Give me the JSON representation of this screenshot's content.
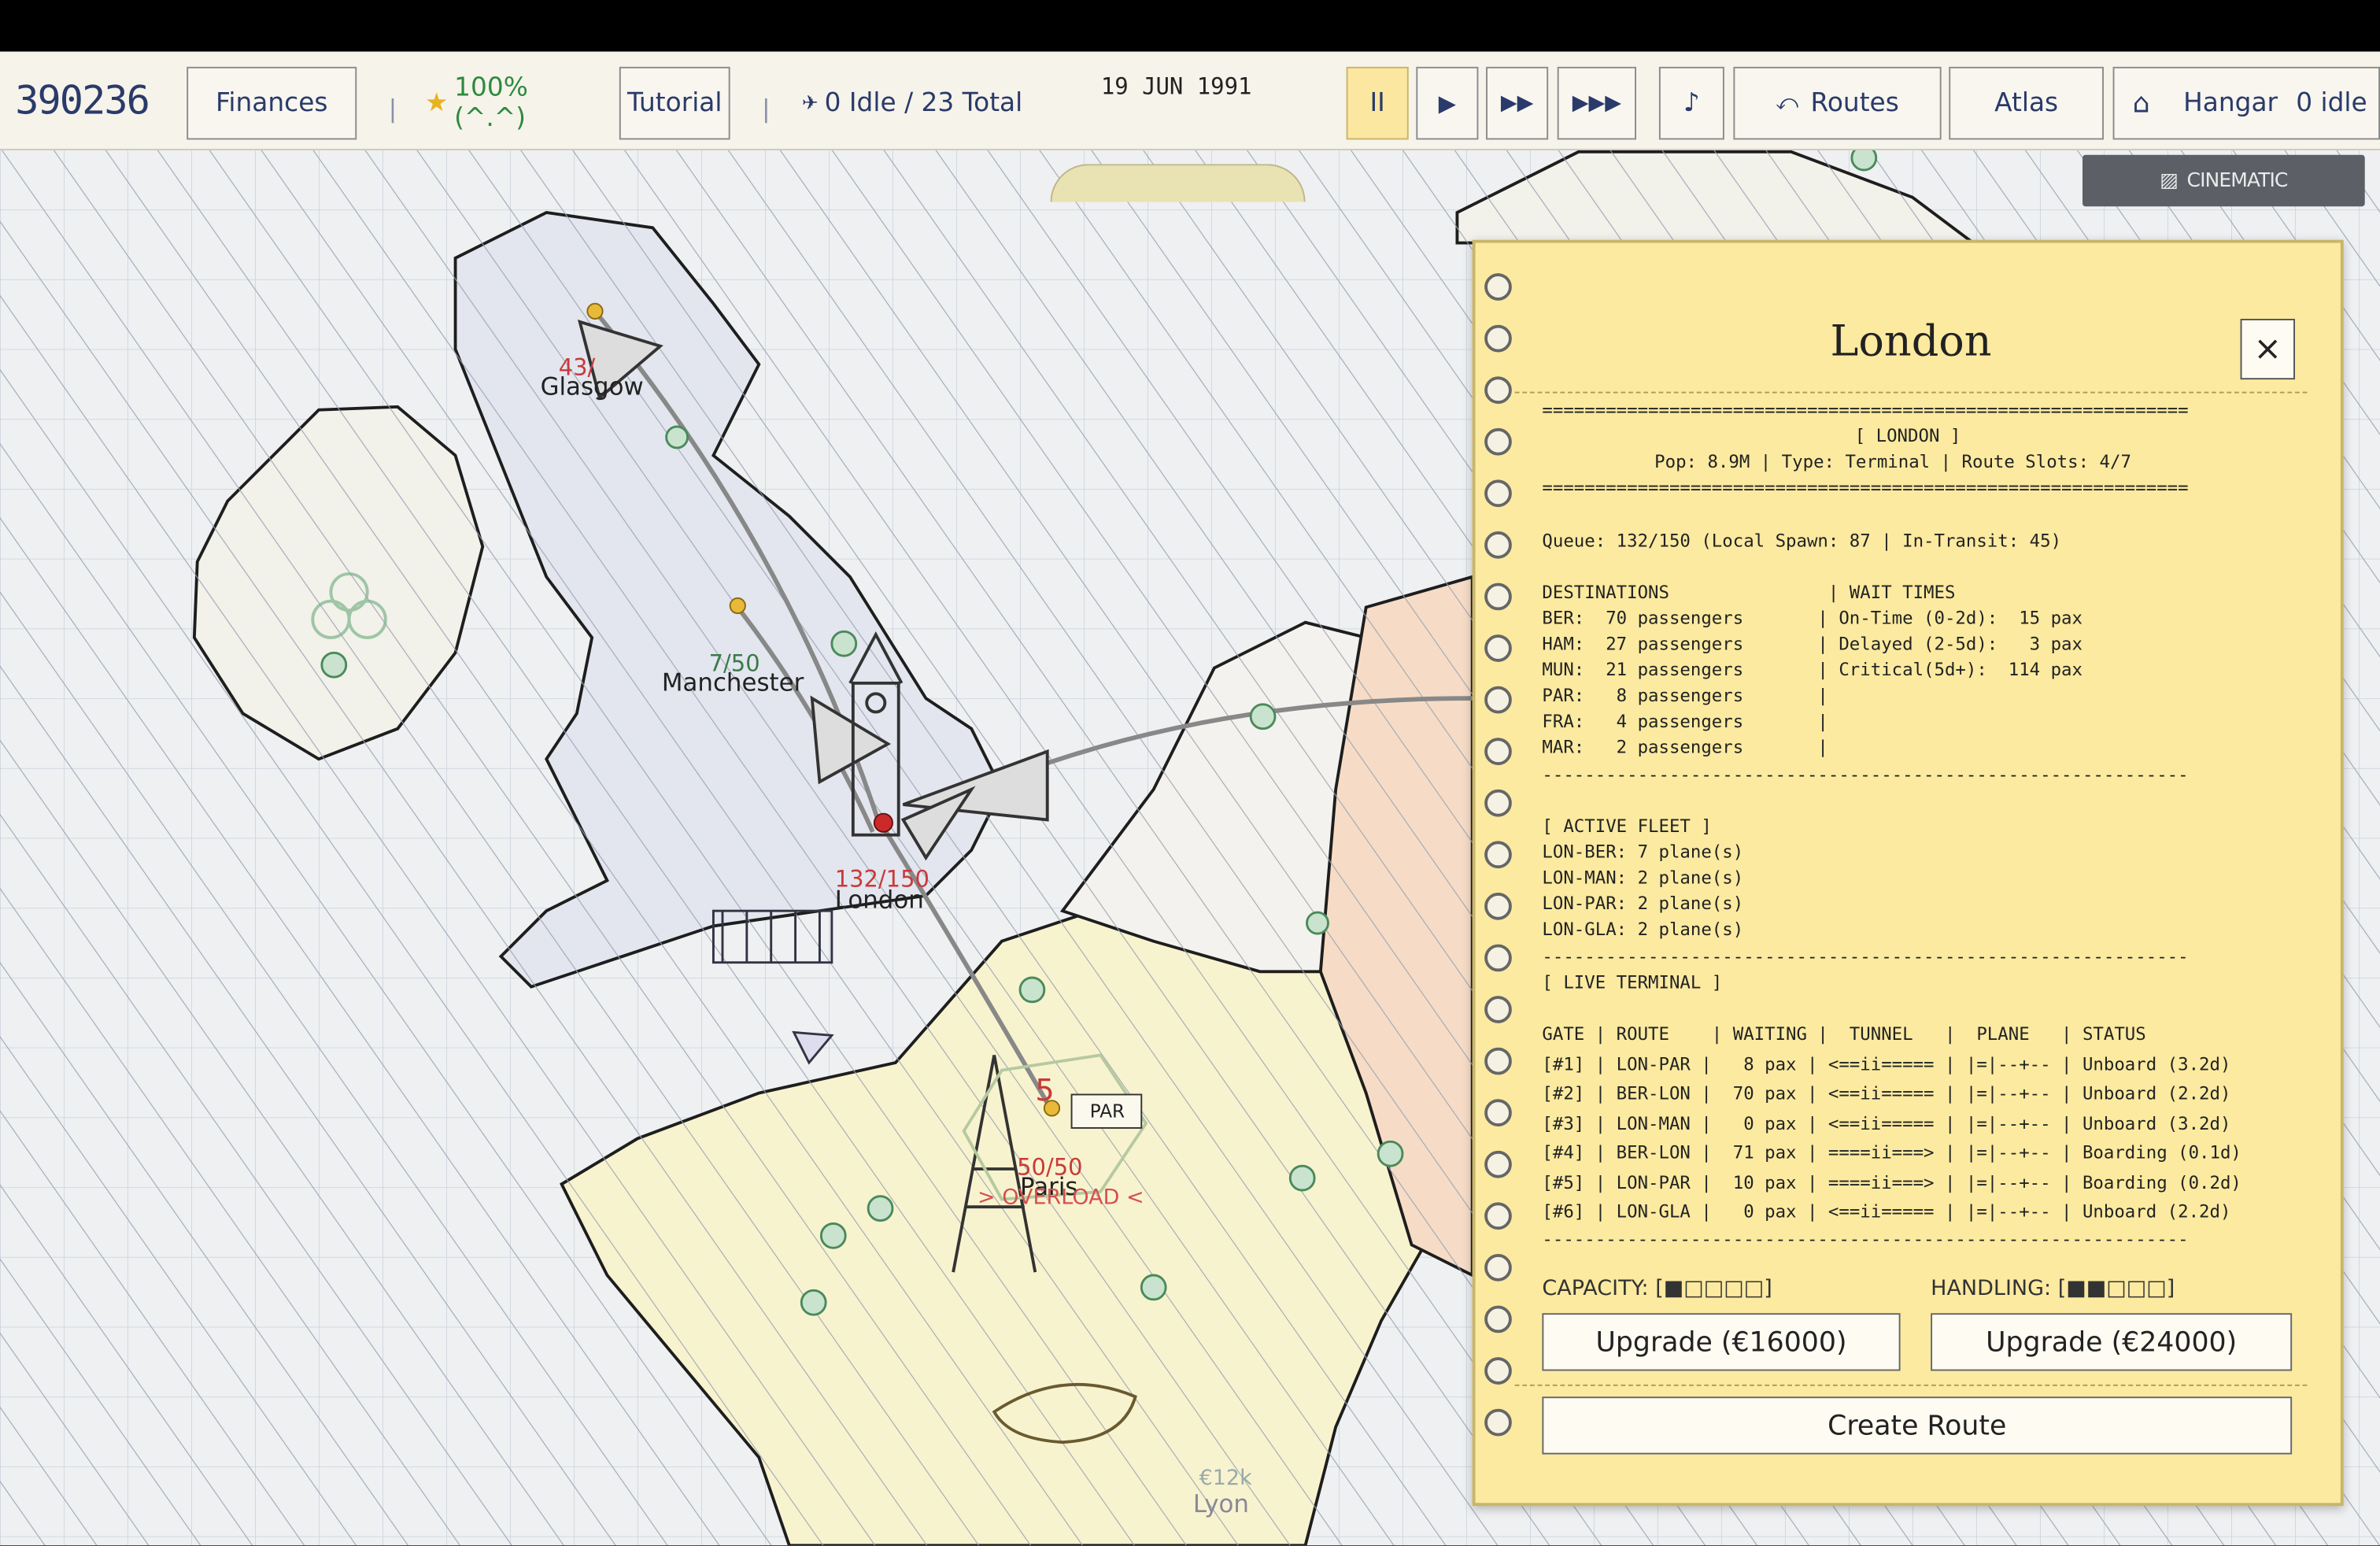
{
  "toolbar": {
    "money": "390236",
    "finances": "Finances",
    "rating": "100% (^.^)",
    "tutorial": "Tutorial",
    "fleet": "0 Idle / 23 Total",
    "date": "19 JUN 1991",
    "pause": "II",
    "play": "▶",
    "fast": "▶▶",
    "faster": "▶▶▶",
    "music": "♪",
    "routes": "Routes",
    "atlas": "Atlas",
    "hangar": "Hangar",
    "hangar_idle": "0 idle",
    "cinematic": "CINEMATIC"
  },
  "map": {
    "cities": [
      {
        "name": "Glasgow",
        "count": "43/"
      },
      {
        "name": "Manchester",
        "count": "7/50"
      },
      {
        "name": "London",
        "count": "132/150"
      },
      {
        "name": "Paris",
        "count": "50/50",
        "warning": "> OVERLOAD <",
        "badge": "5",
        "tag": "PAR"
      },
      {
        "name": "Lyon",
        "count": "€12k"
      }
    ],
    "colors": {
      "sea": "#eef0f2",
      "uk": "#e3e6ee",
      "france": "#f8f3cf",
      "germany": "#f6dcc6",
      "benelux": "#f4f2ee",
      "ireland": "#f2f1ea"
    }
  },
  "panel": {
    "title": "London",
    "close": "×",
    "lines": {
      "rule": "=============================================================",
      "header": "[ LONDON ]",
      "pop": "Pop: 8.9M | Type: Terminal | Route Slots: 4/7",
      "queue": "Queue: 132/150 (Local Spawn: 87 | In-Transit: 45)",
      "dest_head": "DESTINATIONS               | WAIT TIMES",
      "dest": [
        "BER:  70 passengers       | On-Time (0-2d):  15 pax",
        "HAM:  27 passengers       | Delayed (2-5d):   3 pax",
        "MUN:  21 passengers       | Critical(5d+):  114 pax",
        "PAR:   8 passengers       |",
        "FRA:   4 passengers       |",
        "MAR:   2 passengers       |"
      ],
      "dashrule": "-------------------------------------------------------------",
      "fleet_head": "[ ACTIVE FLEET ]",
      "fleet": [
        "LON-BER: 7 plane(s)",
        "LON-MAN: 2 plane(s)",
        "LON-PAR: 2 plane(s)",
        "LON-GLA: 2 plane(s)"
      ],
      "term_head": "[ LIVE TERMINAL ]",
      "term_cols": "GATE | ROUTE    | WAITING |  TUNNEL   |  PLANE   | STATUS",
      "term": [
        "[#1] | LON-PAR |   8 pax | <==ii===== | |=|--+-- | Unboard (3.2d)",
        "[#2] | BER-LON |  70 pax | <==ii===== | |=|--+-- | Unboard (2.2d)",
        "[#3] | LON-MAN |   0 pax | <==ii===== | |=|--+-- | Unboard (3.2d)",
        "[#4] | BER-LON |  71 pax | ====ii===> | |=|--+-- | Boarding (0.1d)",
        "[#5] | LON-PAR |  10 pax | ====ii===> | |=|--+-- | Boarding (0.2d)",
        "[#6] | LON-GLA |   0 pax | <==ii===== | |=|--+-- | Unboard (2.2d)"
      ]
    },
    "capacity_label": "CAPACITY: [■□□□□]",
    "handling_label": "HANDLING: [■■□□□]",
    "upgrade_capacity": "Upgrade (€16000)",
    "upgrade_handling": "Upgrade (€24000)",
    "create_route": "Create Route"
  }
}
